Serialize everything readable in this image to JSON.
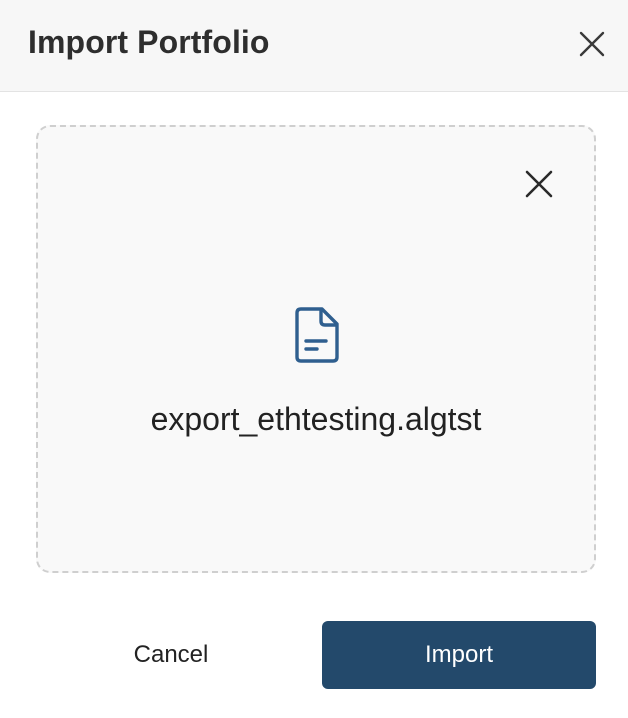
{
  "dialog": {
    "title": "Import Portfolio",
    "close_icon": "close-icon"
  },
  "dropzone": {
    "remove_icon": "close-icon",
    "file_icon": "document-icon",
    "file_name": "export_ethtesting.algtst"
  },
  "actions": {
    "cancel_label": "Cancel",
    "import_label": "Import"
  },
  "colors": {
    "primary": "#23496b",
    "file_icon": "#2f5f8f",
    "header_bg": "#f7f7f7",
    "dropzone_bg": "#f9f9f9"
  }
}
